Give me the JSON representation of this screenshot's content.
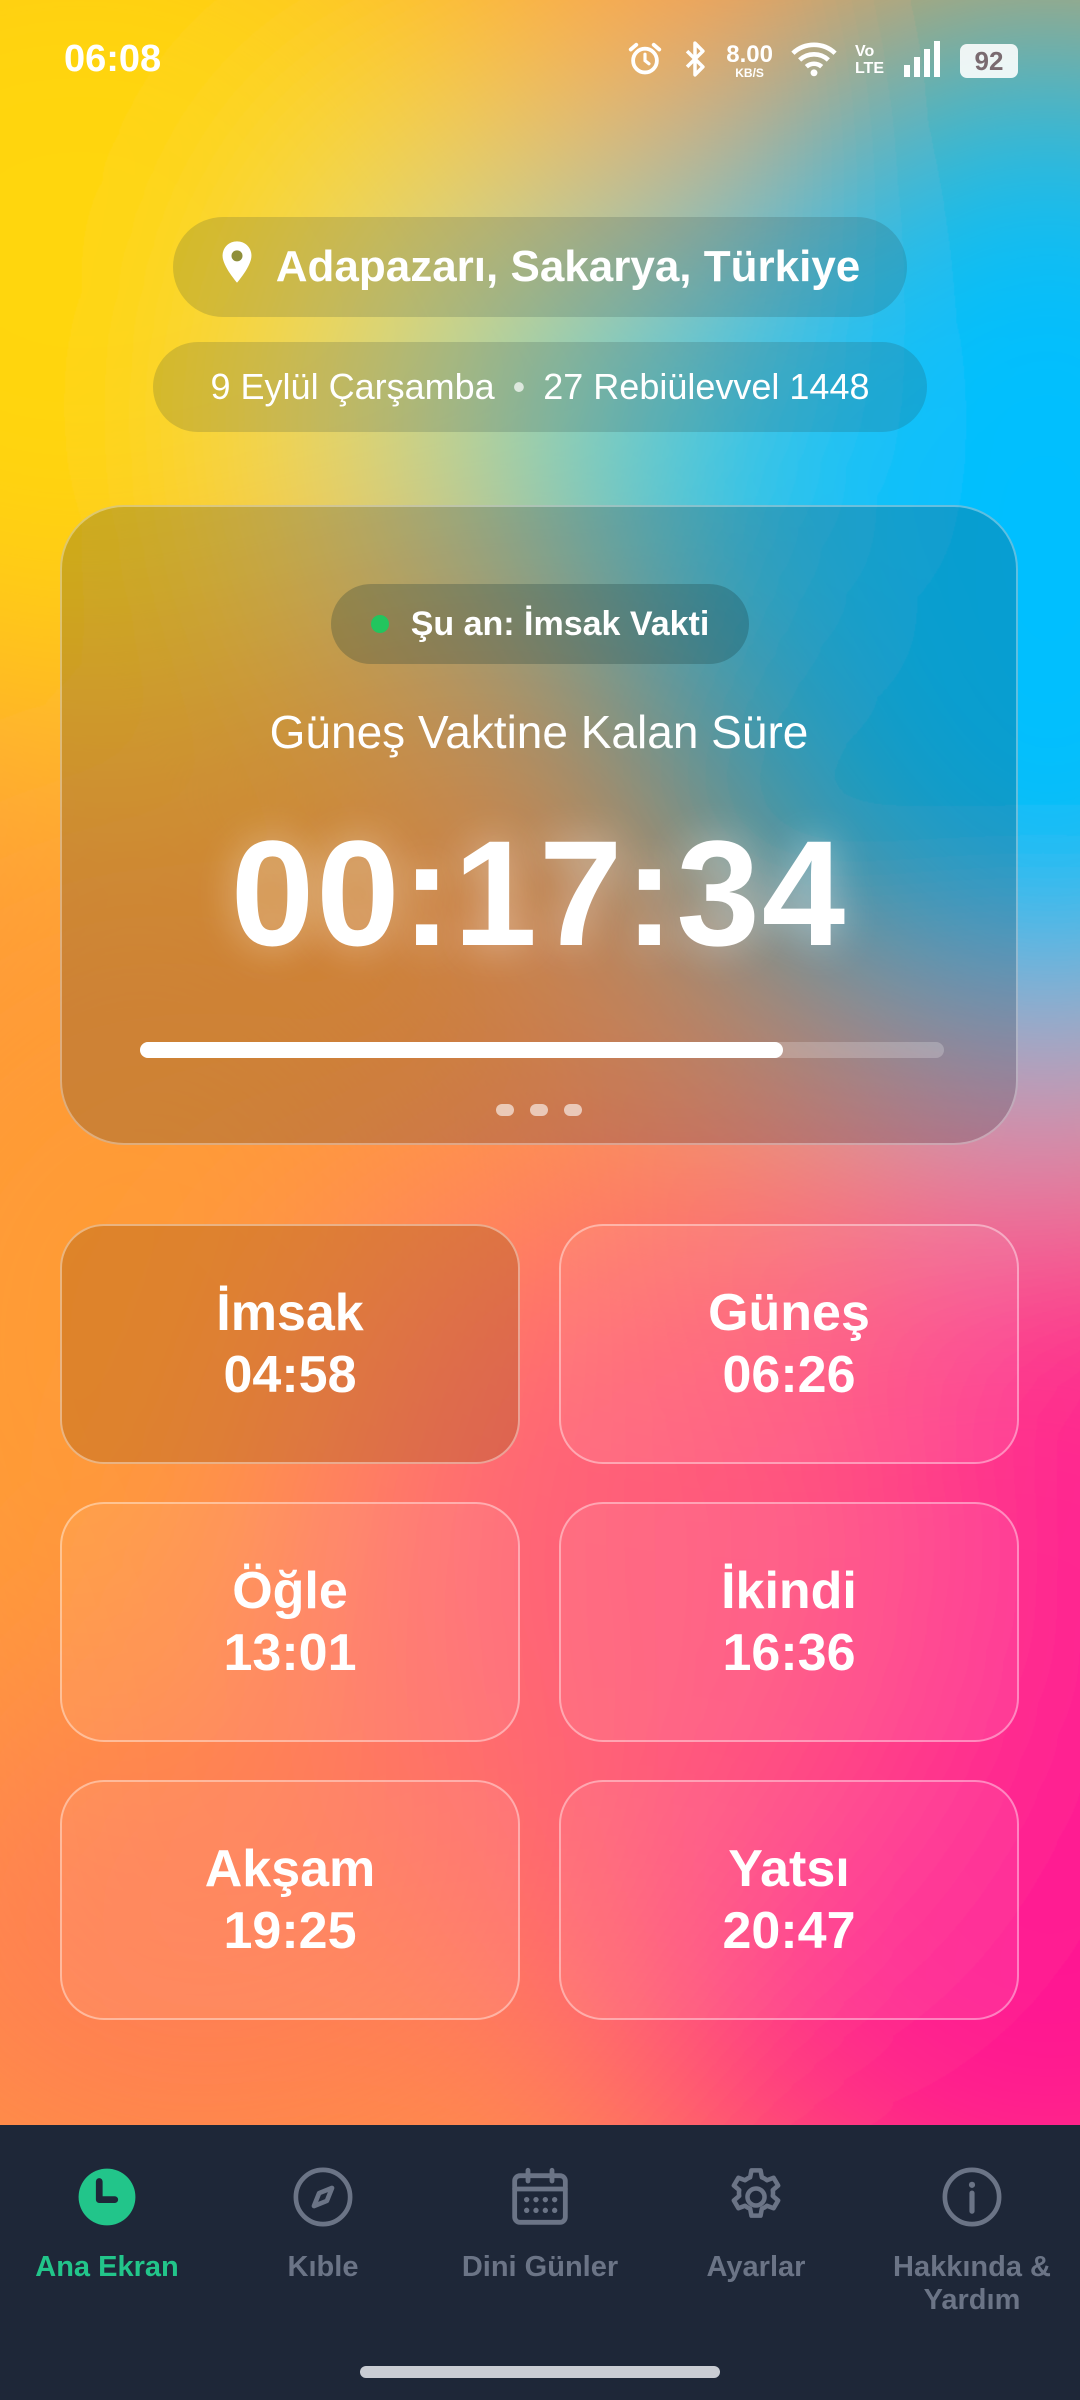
{
  "status_bar": {
    "time": "06:08",
    "net_speed": "8.00",
    "net_unit": "KB/S",
    "volte_top": "Vo",
    "volte_bottom": "LTE",
    "battery": "92"
  },
  "header": {
    "location": "Adapazarı, Sakarya, Türkiye",
    "gregorian_date": "9 Eylül Çarşamba",
    "hijri_date": "27 Rebiülevvel 1448"
  },
  "countdown_card": {
    "current_prayer": "Şu an: İmsak Vakti",
    "remaining_label": "Güneş Vaktine Kalan Süre",
    "remaining_time": "00:17:34",
    "progress_fraction": 0.8
  },
  "prayers": [
    {
      "name": "İmsak",
      "time": "04:58",
      "active": true
    },
    {
      "name": "Güneş",
      "time": "06:26",
      "active": false
    },
    {
      "name": "Öğle",
      "time": "13:01",
      "active": false
    },
    {
      "name": "İkindi",
      "time": "16:36",
      "active": false
    },
    {
      "name": "Akşam",
      "time": "19:25",
      "active": false
    },
    {
      "name": "Yatsı",
      "time": "20:47",
      "active": false
    }
  ],
  "nav": {
    "items": [
      {
        "label": "Ana Ekran",
        "icon": "clock-icon",
        "active": true
      },
      {
        "label": "Kıble",
        "icon": "compass-icon",
        "active": false
      },
      {
        "label": "Dini Günler",
        "icon": "calendar-icon",
        "active": false
      },
      {
        "label": "Ayarlar",
        "icon": "gear-icon",
        "active": false
      },
      {
        "label": "Hakkında & Yardım",
        "icon": "info-icon",
        "active": false
      }
    ]
  },
  "colors": {
    "accent": "#22c58a",
    "nav_bg": "#1e2738",
    "active_dot": "#22c55e"
  }
}
